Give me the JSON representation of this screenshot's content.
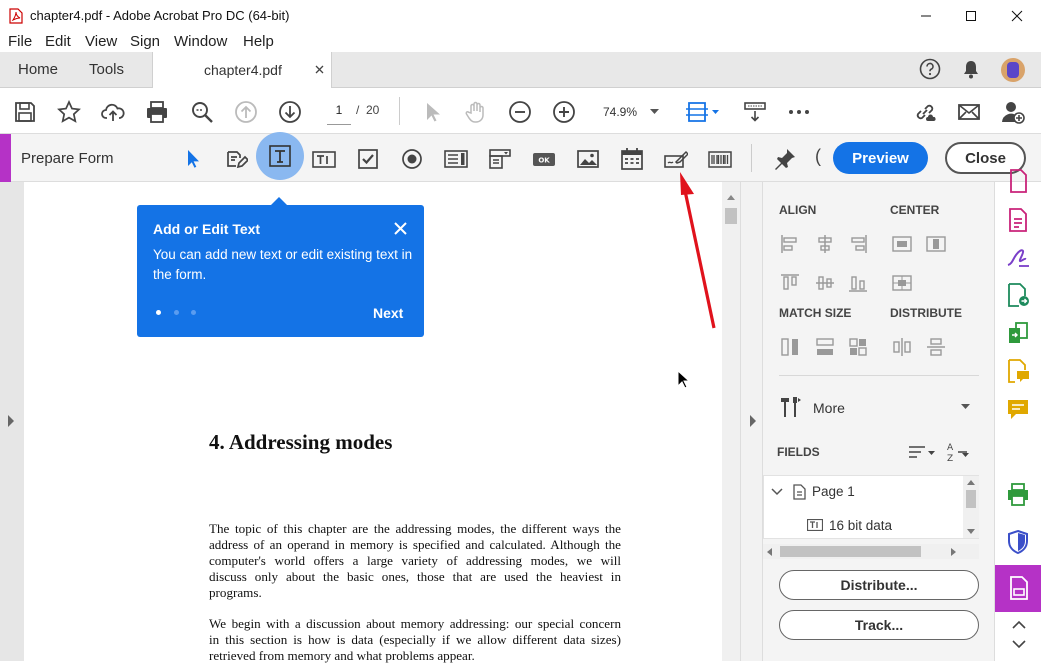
{
  "window": {
    "title": "chapter4.pdf - Adobe Acrobat Pro DC (64-bit)"
  },
  "menu": [
    "File",
    "Edit",
    "View",
    "Sign",
    "Window",
    "Help"
  ],
  "tabs": {
    "home": "Home",
    "tools": "Tools",
    "document": "chapter4.pdf"
  },
  "toolbar": {
    "page_current": "1",
    "page_separator": "/",
    "page_total": "20",
    "zoom": "74.9%"
  },
  "formbar": {
    "title": "Prepare Form",
    "preview_label": "Preview",
    "close_label": "Close"
  },
  "tooltip": {
    "title": "Add or Edit Text",
    "body": "You can add new text or edit existing text in the form.",
    "next_label": "Next",
    "pages": 3,
    "current_page": 1
  },
  "document": {
    "heading": "4. Addressing modes",
    "paragraph1": [
      "The topic of this chapter are the addressing modes, the different ways the",
      "address of an operand in memory is specified and calculated. Although the",
      "computer's world offers a large variety of addressing modes, we will",
      "discuss only about the basic ones, those that are used the heaviest in",
      "programs."
    ],
    "paragraph2": [
      "We begin with a discussion about memory addressing: our special concern",
      "in this section is how is data (especially if we allow different data sizes)",
      "retrieved from memory and what problems appear."
    ]
  },
  "panel": {
    "align_label": "ALIGN",
    "center_label": "CENTER",
    "match_size_label": "MATCH SIZE",
    "distribute_label": "DISTRIBUTE",
    "more_label": "More",
    "fields_label": "FIELDS",
    "tree_page": "Page 1",
    "tree_field": "16 bit data",
    "distribute_button": "Distribute...",
    "track_button": "Track..."
  },
  "colors": {
    "accent": "#1473e6",
    "form_accent": "#b532c6",
    "arrow": "#e0121c"
  }
}
